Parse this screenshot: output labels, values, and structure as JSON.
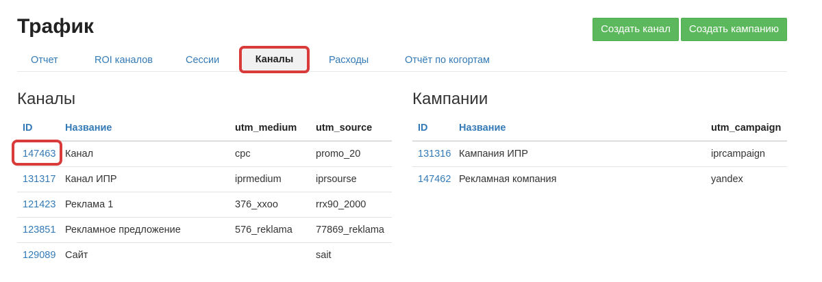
{
  "header": {
    "title": "Трафик",
    "create_channel_label": "Создать канал",
    "create_campaign_label": "Создать кампанию"
  },
  "tabs": [
    {
      "label": "Отчет"
    },
    {
      "label": "ROI каналов"
    },
    {
      "label": "Сессии"
    },
    {
      "label": "Каналы",
      "active": true
    },
    {
      "label": "Расходы"
    },
    {
      "label": "Отчёт по когортам"
    }
  ],
  "channels": {
    "title": "Каналы",
    "columns": [
      "ID",
      "Название",
      "utm_medium",
      "utm_source"
    ],
    "rows": [
      {
        "id": "147463",
        "name": "Канал",
        "medium": "cpc",
        "source": "promo_20"
      },
      {
        "id": "131317",
        "name": "Канал ИПР",
        "medium": "iprmedium",
        "source": "iprsourse"
      },
      {
        "id": "121423",
        "name": "Реклама 1",
        "medium": "376_xxoo",
        "source": "rrx90_2000"
      },
      {
        "id": "123851",
        "name": "Рекламное предложение",
        "medium": "576_reklama",
        "source": "77869_reklama"
      },
      {
        "id": "129089",
        "name": "Сайт",
        "medium": "",
        "source": "sait"
      }
    ]
  },
  "campaigns": {
    "title": "Кампании",
    "columns": [
      "ID",
      "Название",
      "utm_campaign"
    ],
    "rows": [
      {
        "id": "131316",
        "name": "Кампания ИПР",
        "campaign": "iprcampaign"
      },
      {
        "id": "147462",
        "name": "Рекламная компания",
        "campaign": "yandex"
      }
    ]
  },
  "colors": {
    "accent_green": "#5cb85c",
    "link_blue": "#337ab7",
    "highlight_red": "#d93a3a"
  }
}
